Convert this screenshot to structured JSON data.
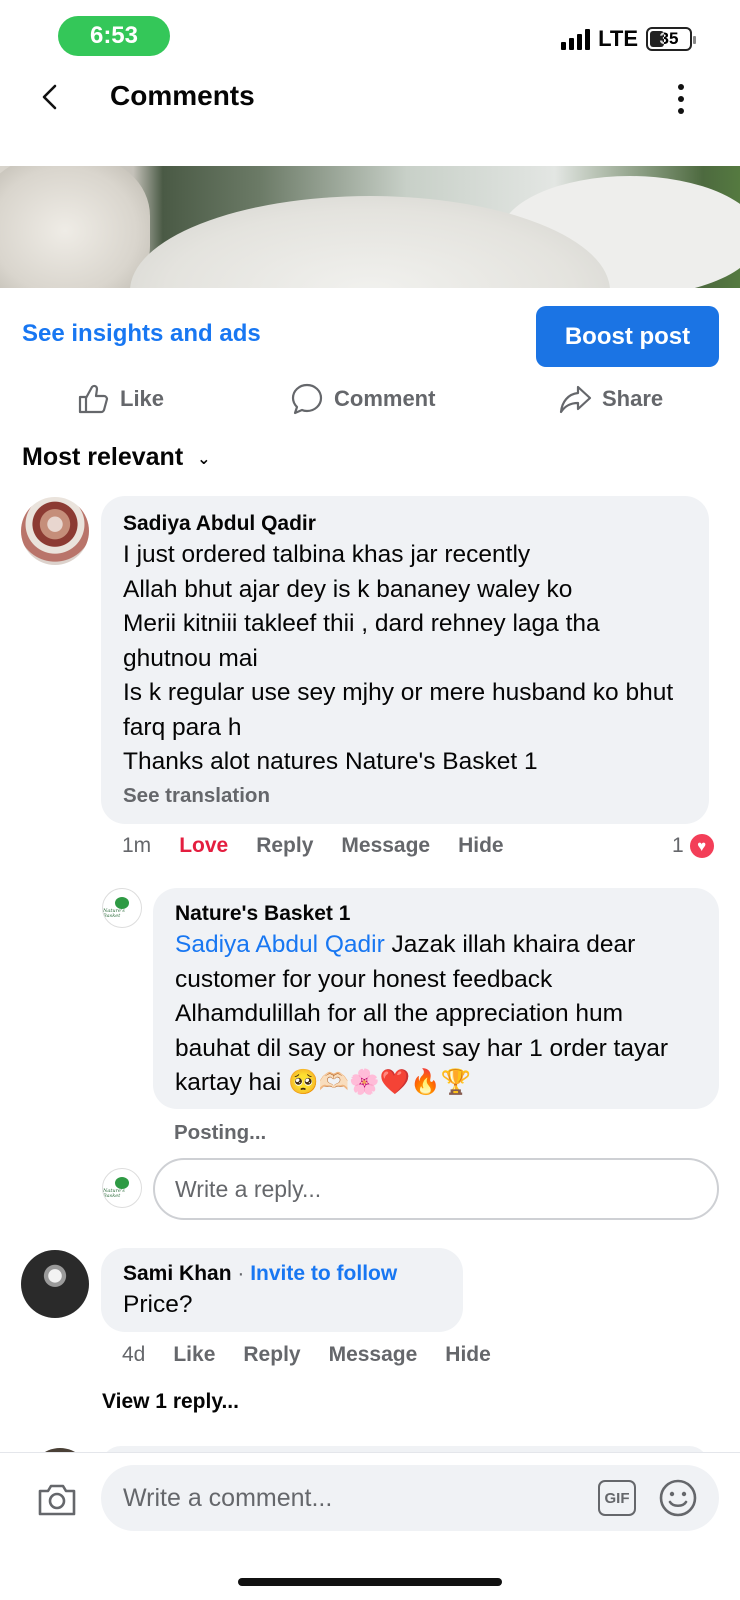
{
  "status": {
    "time": "6:53",
    "network": "LTE",
    "battery": "35"
  },
  "header": {
    "title": "Comments"
  },
  "post": {
    "insights_label": "See insights and ads",
    "boost_label": "Boost post",
    "actions": {
      "like": "Like",
      "comment": "Comment",
      "share": "Share"
    }
  },
  "sort": {
    "label": "Most relevant"
  },
  "comments": [
    {
      "author": "Sadiya Abdul Qadir",
      "text": "I just ordered talbina khas jar recently\nAllah bhut ajar dey is k bananey waley ko\nMerii kitniii takleef thii , dard rehney laga tha ghutnou mai\nIs k regular use sey mjhy or mere husband ko bhut farq para h\nThanks alot natures Nature's Basket 1",
      "see_translation": "See translation",
      "time": "1m",
      "reaction_label": "Love",
      "reply": "Reply",
      "message": "Message",
      "hide": "Hide",
      "reaction_count": "1",
      "reply_item": {
        "author": "Nature's Basket 1",
        "mention": "Sadiya Abdul Qadir",
        "text": " Jazak illah khaira dear customer for your honest feedback Alhamdulillah for all the appreciation hum bauhat dil say or honest say har 1 order tayar kartay hai 🥺🫶🏻🌸❤️🔥🏆",
        "status": "Posting...",
        "logo_text": "Nature's Basket"
      },
      "reply_placeholder": "Write a reply..."
    },
    {
      "author": "Sami Khan",
      "separator": " · ",
      "invite": "Invite to follow",
      "text": "Price?",
      "time": "4d",
      "like": "Like",
      "reply": "Reply",
      "message": "Message",
      "hide": "Hide",
      "view_replies": "View 1 reply..."
    }
  ],
  "composer": {
    "placeholder": "Write a comment...",
    "gif": "GIF"
  },
  "colors": {
    "accent": "#1877f2",
    "love": "#e41e3f",
    "status_green": "#34c759"
  }
}
